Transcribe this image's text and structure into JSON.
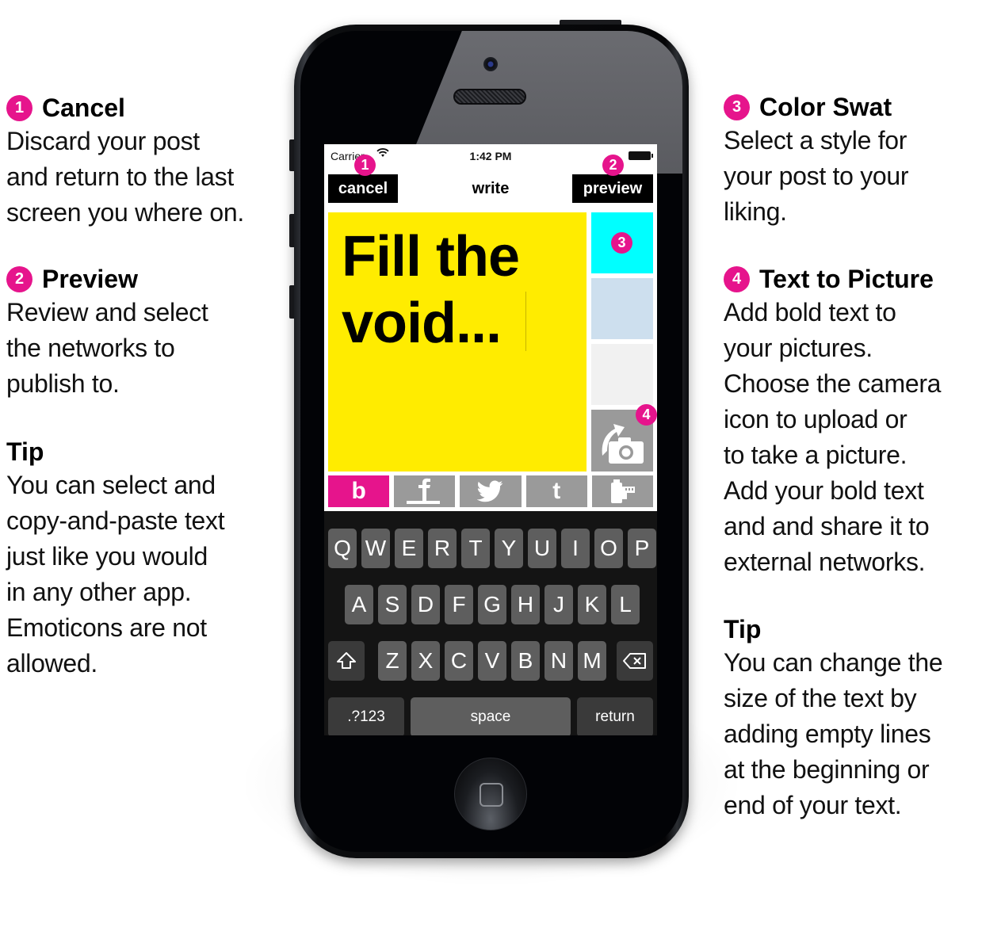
{
  "annotations": {
    "left": [
      {
        "badge": "1",
        "title": "Cancel",
        "body": "Discard your post\nand return to the last\nscreen you where on."
      },
      {
        "badge": "2",
        "title": "Preview",
        "body": "Review and select\nthe networks to\npublish to."
      }
    ],
    "left_tip": {
      "title": "Tip",
      "body": "You can select and\ncopy-and-paste text\njust like you would\nin any other app.\nEmoticons are not\nallowed."
    },
    "right": [
      {
        "badge": "3",
        "title": "Color Swat",
        "body": "Select a style for\nyour post to your\nliking."
      },
      {
        "badge": "4",
        "title": "Text to Picture",
        "body": "Add bold text to\nyour pictures.\nChoose the camera\nicon to upload or\nto take a picture.\nAdd your bold text\nand and share it to\nexternal networks."
      }
    ],
    "right_tip": {
      "title": "Tip",
      "body": "You can change the\nsize of the text by\nadding empty lines\nat the beginning or\nend of your text."
    }
  },
  "status_bar": {
    "carrier": "Carrier",
    "time": "1:42 PM",
    "wifi_icon": "wifi-icon",
    "battery_icon": "battery-icon"
  },
  "navbar": {
    "cancel_label": "cancel",
    "title": "write",
    "preview_label": "preview"
  },
  "callouts": {
    "cancel": "1",
    "preview": "2",
    "swatch": "3",
    "photo": "4"
  },
  "editor": {
    "text": "Fill the\nvoid...",
    "background": "#ffec00"
  },
  "swatches": [
    {
      "name": "cyan",
      "color": "#00ffff"
    },
    {
      "name": "light-blue",
      "color": "#cddfee"
    },
    {
      "name": "light-gray",
      "color": "#f1f1f1"
    }
  ],
  "photo_button": {
    "icon": "camera-upload-icon"
  },
  "tabs": [
    {
      "label": "b",
      "icon": "bold-app-icon",
      "active": true
    },
    {
      "label": "f",
      "icon": "facebook-icon",
      "active": false
    },
    {
      "label": "",
      "icon": "twitter-icon",
      "active": false
    },
    {
      "label": "t",
      "icon": "tumblr-icon",
      "active": false
    },
    {
      "label": "",
      "icon": "film-roll-icon",
      "active": false
    }
  ],
  "keyboard": {
    "row1": [
      "Q",
      "W",
      "E",
      "R",
      "T",
      "Y",
      "U",
      "I",
      "O",
      "P"
    ],
    "row2": [
      "A",
      "S",
      "D",
      "F",
      "G",
      "H",
      "J",
      "K",
      "L"
    ],
    "row3": [
      "Z",
      "X",
      "C",
      "V",
      "B",
      "N",
      "M"
    ],
    "shift_icon": "shift-icon",
    "backspace_icon": "backspace-icon",
    "numbers_label": ".?123",
    "space_label": "space",
    "return_label": "return"
  },
  "colors": {
    "accent": "#e6148c",
    "editor_bg": "#ffec00",
    "tab_gray": "#9a9a9a",
    "key_bg": "#5e5e5e"
  }
}
